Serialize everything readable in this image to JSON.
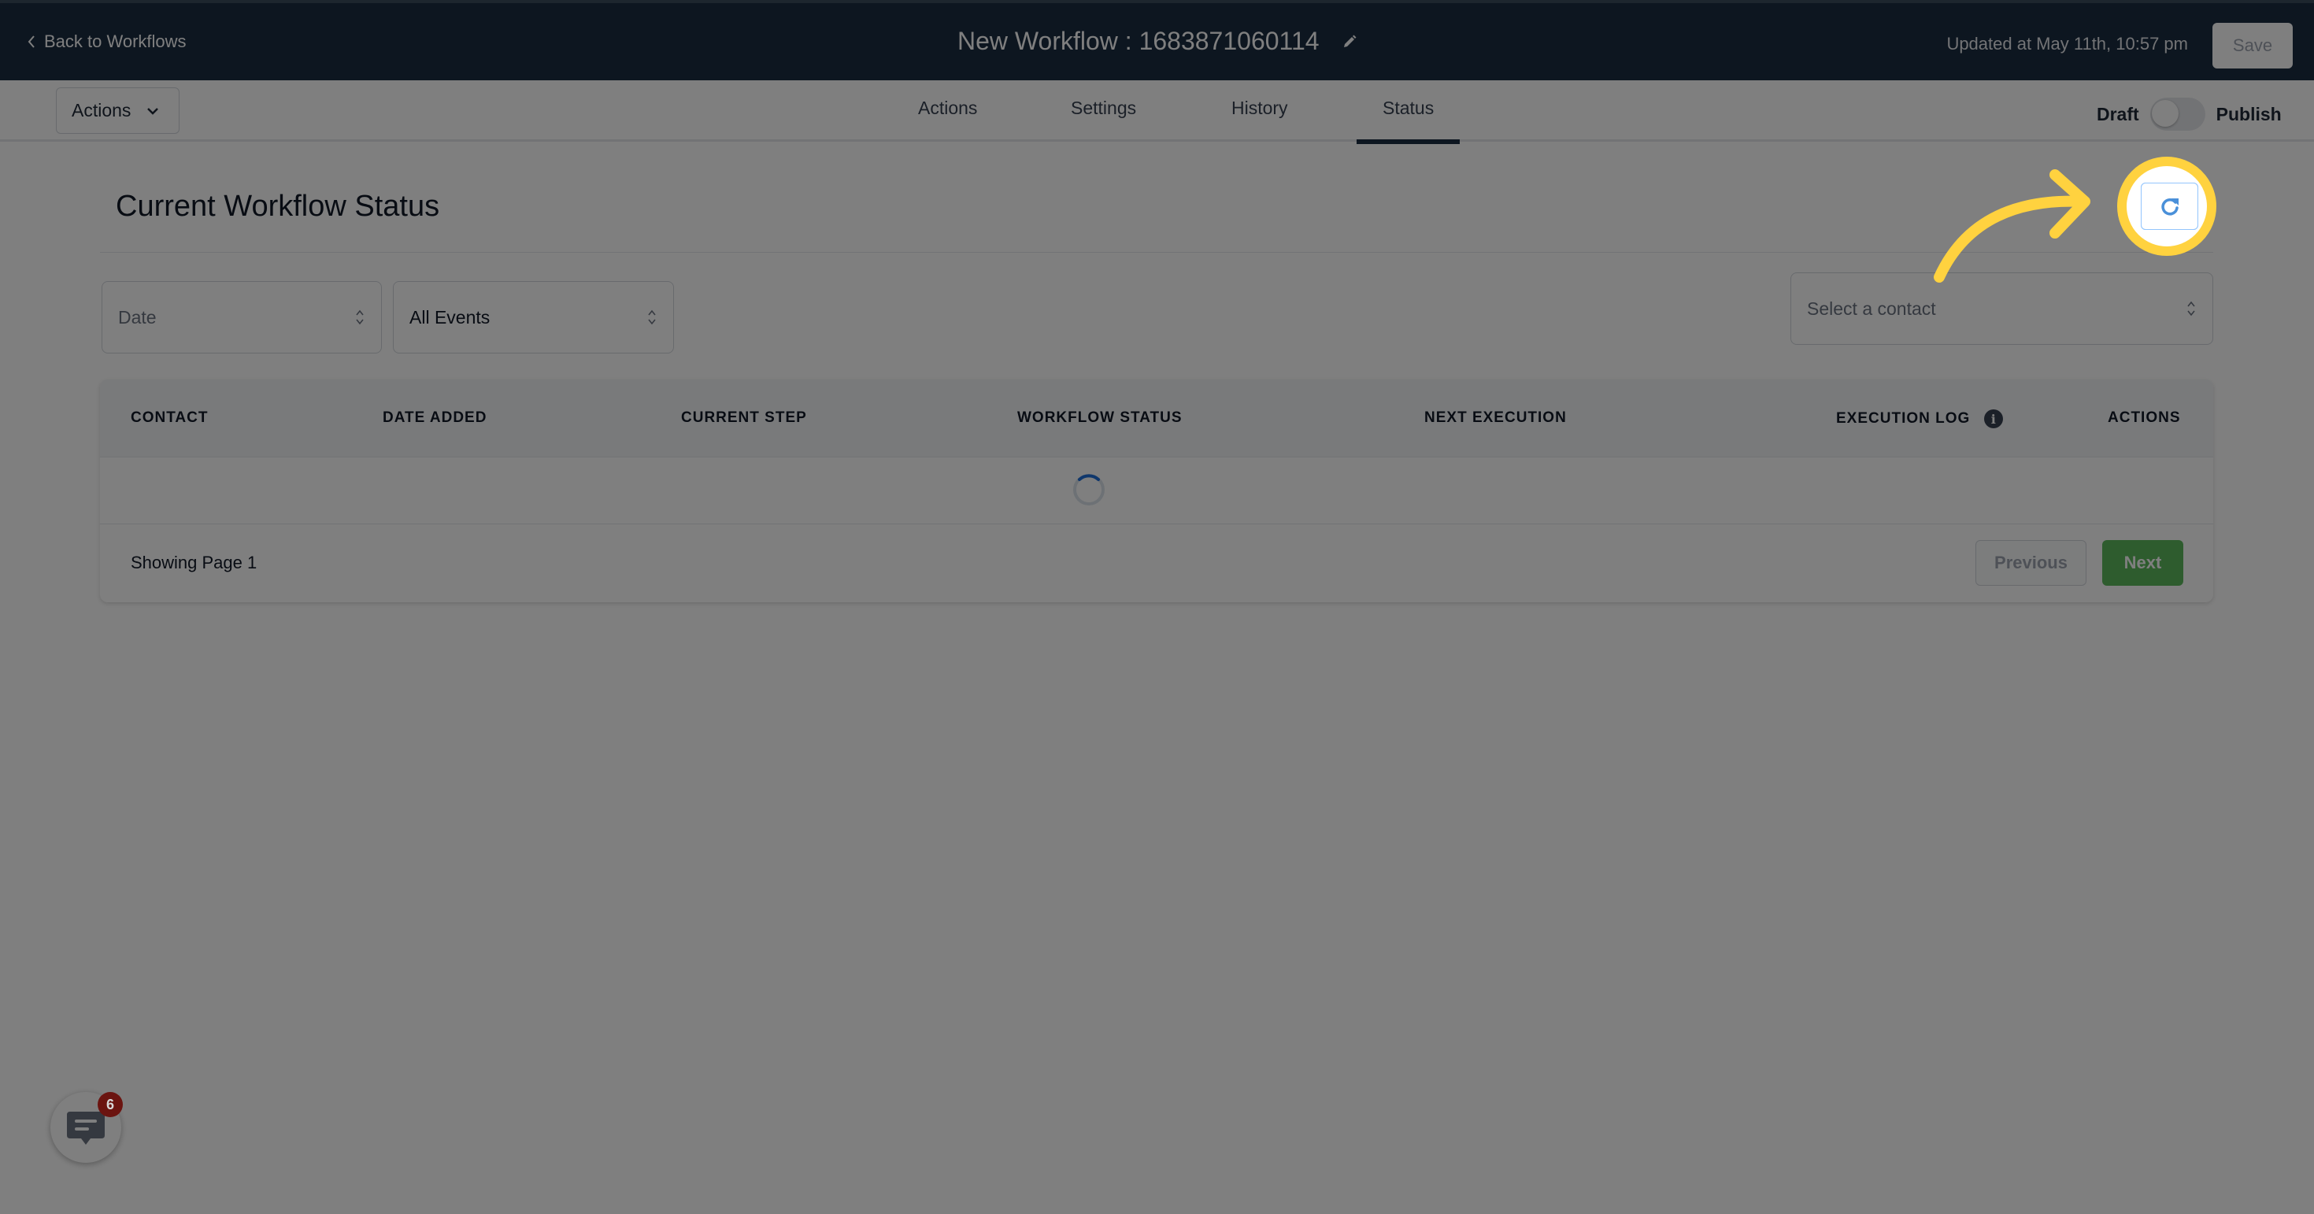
{
  "header": {
    "back_label": "Back to Workflows",
    "workflow_title": "New Workflow : 1683871060114",
    "updated_text": "Updated at May 11th, 10:57 pm",
    "save_label": "Save"
  },
  "subnav": {
    "actions_dropdown_label": "Actions",
    "tabs": [
      {
        "label": "Actions",
        "active": false
      },
      {
        "label": "Settings",
        "active": false
      },
      {
        "label": "History",
        "active": false
      },
      {
        "label": "Status",
        "active": true
      }
    ],
    "toggle": {
      "left_label": "Draft",
      "right_label": "Publish",
      "state": "Draft"
    }
  },
  "main": {
    "title": "Current Workflow Status",
    "filters": {
      "date": {
        "placeholder": "Date"
      },
      "events": {
        "value": "All Events"
      },
      "contact": {
        "placeholder": "Select a contact"
      }
    },
    "refresh_icon": "refresh-icon",
    "table": {
      "columns": [
        "CONTACT",
        "DATE ADDED",
        "CURRENT STEP",
        "WORKFLOW STATUS",
        "NEXT EXECUTION",
        "EXECUTION LOG",
        "ACTIONS"
      ],
      "rows": [],
      "loading": true,
      "footer": {
        "showing_text": "Showing Page 1",
        "previous_label": "Previous",
        "next_label": "Next"
      }
    }
  },
  "chat_widget": {
    "icon": "chat-icon",
    "badge_count": "6"
  },
  "colors": {
    "header_bg": "#1a2c40",
    "next_button": "#5cb85c",
    "annotation_highlight": "#ffd23f",
    "refresh_icon": "#4a90d9"
  }
}
